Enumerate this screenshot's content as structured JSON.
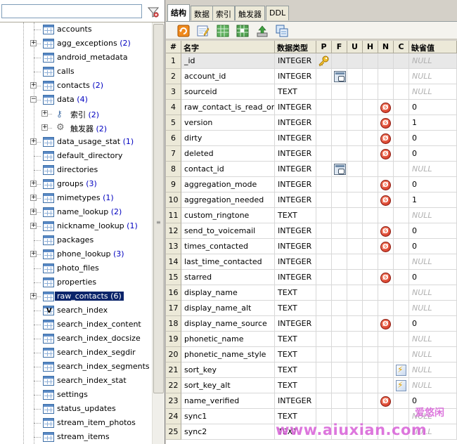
{
  "tabs": [
    {
      "label": "结构",
      "active": true
    },
    {
      "label": "数据",
      "active": false
    },
    {
      "label": "索引",
      "active": false
    },
    {
      "label": "触发器",
      "active": false
    },
    {
      "label": "DDL",
      "active": false
    }
  ],
  "tree": {
    "items": [
      {
        "label": "accounts",
        "count": "",
        "expandable": false,
        "kind": "table"
      },
      {
        "label": "agg_exceptions",
        "count": "(2)",
        "expandable": true,
        "kind": "table"
      },
      {
        "label": "android_metadata",
        "count": "",
        "expandable": false,
        "kind": "table"
      },
      {
        "label": "calls",
        "count": "",
        "expandable": false,
        "kind": "table"
      },
      {
        "label": "contacts",
        "count": "(2)",
        "expandable": true,
        "kind": "table"
      },
      {
        "label": "data",
        "count": "(4)",
        "expandable": true,
        "expanded": true,
        "kind": "table"
      },
      {
        "label": "索引",
        "count": "(2)",
        "expandable": true,
        "kind": "index",
        "child": true
      },
      {
        "label": "触发器",
        "count": "(2)",
        "expandable": true,
        "kind": "trigger",
        "child": true
      },
      {
        "label": "data_usage_stat",
        "count": "(1)",
        "expandable": true,
        "kind": "table"
      },
      {
        "label": "default_directory",
        "count": "",
        "expandable": false,
        "kind": "table"
      },
      {
        "label": "directories",
        "count": "",
        "expandable": false,
        "kind": "table"
      },
      {
        "label": "groups",
        "count": "(3)",
        "expandable": true,
        "kind": "table"
      },
      {
        "label": "mimetypes",
        "count": "(1)",
        "expandable": true,
        "kind": "table"
      },
      {
        "label": "name_lookup",
        "count": "(2)",
        "expandable": true,
        "kind": "table"
      },
      {
        "label": "nickname_lookup",
        "count": "(1)",
        "expandable": true,
        "kind": "table"
      },
      {
        "label": "packages",
        "count": "",
        "expandable": false,
        "kind": "table"
      },
      {
        "label": "phone_lookup",
        "count": "(3)",
        "expandable": true,
        "kind": "table"
      },
      {
        "label": "photo_files",
        "count": "",
        "expandable": false,
        "kind": "table"
      },
      {
        "label": "properties",
        "count": "",
        "expandable": false,
        "kind": "table"
      },
      {
        "label": "raw_contacts",
        "count": "(6)",
        "expandable": true,
        "kind": "table",
        "selected": true
      },
      {
        "label": "search_index",
        "count": "",
        "expandable": false,
        "kind": "virtual"
      },
      {
        "label": "search_index_content",
        "count": "",
        "expandable": false,
        "kind": "table"
      },
      {
        "label": "search_index_docsize",
        "count": "",
        "expandable": false,
        "kind": "table"
      },
      {
        "label": "search_index_segdir",
        "count": "",
        "expandable": false,
        "kind": "table"
      },
      {
        "label": "search_index_segments",
        "count": "",
        "expandable": false,
        "kind": "table"
      },
      {
        "label": "search_index_stat",
        "count": "",
        "expandable": false,
        "kind": "table"
      },
      {
        "label": "settings",
        "count": "",
        "expandable": false,
        "kind": "table"
      },
      {
        "label": "status_updates",
        "count": "",
        "expandable": false,
        "kind": "table"
      },
      {
        "label": "stream_item_photos",
        "count": "",
        "expandable": false,
        "kind": "table"
      },
      {
        "label": "stream_items",
        "count": "",
        "expandable": false,
        "kind": "table"
      }
    ]
  },
  "grid": {
    "headers": [
      "#",
      "名字",
      "数据类型",
      "P",
      "F",
      "U",
      "H",
      "N",
      "C",
      "缺省值"
    ],
    "null_text": "NULL",
    "rows": [
      {
        "n": "1",
        "name": "_id",
        "type": "INTEGER",
        "p": true,
        "f": false,
        "notnull": false,
        "collate": false,
        "def": "NULL",
        "is_null": true
      },
      {
        "n": "2",
        "name": "account_id",
        "type": "INTEGER",
        "p": false,
        "f": true,
        "notnull": false,
        "collate": false,
        "def": "NULL",
        "is_null": true
      },
      {
        "n": "3",
        "name": "sourceid",
        "type": "TEXT",
        "p": false,
        "f": false,
        "notnull": false,
        "collate": false,
        "def": "NULL",
        "is_null": true
      },
      {
        "n": "4",
        "name": "raw_contact_is_read_only",
        "type": "INTEGER",
        "p": false,
        "f": false,
        "notnull": true,
        "collate": false,
        "def": "0",
        "is_null": false
      },
      {
        "n": "5",
        "name": "version",
        "type": "INTEGER",
        "p": false,
        "f": false,
        "notnull": true,
        "collate": false,
        "def": "1",
        "is_null": false
      },
      {
        "n": "6",
        "name": "dirty",
        "type": "INTEGER",
        "p": false,
        "f": false,
        "notnull": true,
        "collate": false,
        "def": "0",
        "is_null": false
      },
      {
        "n": "7",
        "name": "deleted",
        "type": "INTEGER",
        "p": false,
        "f": false,
        "notnull": true,
        "collate": false,
        "def": "0",
        "is_null": false
      },
      {
        "n": "8",
        "name": "contact_id",
        "type": "INTEGER",
        "p": false,
        "f": true,
        "notnull": false,
        "collate": false,
        "def": "NULL",
        "is_null": true
      },
      {
        "n": "9",
        "name": "aggregation_mode",
        "type": "INTEGER",
        "p": false,
        "f": false,
        "notnull": true,
        "collate": false,
        "def": "0",
        "is_null": false
      },
      {
        "n": "10",
        "name": "aggregation_needed",
        "type": "INTEGER",
        "p": false,
        "f": false,
        "notnull": true,
        "collate": false,
        "def": "1",
        "is_null": false
      },
      {
        "n": "11",
        "name": "custom_ringtone",
        "type": "TEXT",
        "p": false,
        "f": false,
        "notnull": false,
        "collate": false,
        "def": "NULL",
        "is_null": true
      },
      {
        "n": "12",
        "name": "send_to_voicemail",
        "type": "INTEGER",
        "p": false,
        "f": false,
        "notnull": true,
        "collate": false,
        "def": "0",
        "is_null": false
      },
      {
        "n": "13",
        "name": "times_contacted",
        "type": "INTEGER",
        "p": false,
        "f": false,
        "notnull": true,
        "collate": false,
        "def": "0",
        "is_null": false
      },
      {
        "n": "14",
        "name": "last_time_contacted",
        "type": "INTEGER",
        "p": false,
        "f": false,
        "notnull": false,
        "collate": false,
        "def": "NULL",
        "is_null": true
      },
      {
        "n": "15",
        "name": "starred",
        "type": "INTEGER",
        "p": false,
        "f": false,
        "notnull": true,
        "collate": false,
        "def": "0",
        "is_null": false
      },
      {
        "n": "16",
        "name": "display_name",
        "type": "TEXT",
        "p": false,
        "f": false,
        "notnull": false,
        "collate": false,
        "def": "NULL",
        "is_null": true
      },
      {
        "n": "17",
        "name": "display_name_alt",
        "type": "TEXT",
        "p": false,
        "f": false,
        "notnull": false,
        "collate": false,
        "def": "NULL",
        "is_null": true
      },
      {
        "n": "18",
        "name": "display_name_source",
        "type": "INTEGER",
        "p": false,
        "f": false,
        "notnull": true,
        "collate": false,
        "def": "0",
        "is_null": false
      },
      {
        "n": "19",
        "name": "phonetic_name",
        "type": "TEXT",
        "p": false,
        "f": false,
        "notnull": false,
        "collate": false,
        "def": "NULL",
        "is_null": true
      },
      {
        "n": "20",
        "name": "phonetic_name_style",
        "type": "TEXT",
        "p": false,
        "f": false,
        "notnull": false,
        "collate": false,
        "def": "NULL",
        "is_null": true
      },
      {
        "n": "21",
        "name": "sort_key",
        "type": "TEXT",
        "p": false,
        "f": false,
        "notnull": false,
        "collate": true,
        "def": "NULL",
        "is_null": true
      },
      {
        "n": "22",
        "name": "sort_key_alt",
        "type": "TEXT",
        "p": false,
        "f": false,
        "notnull": false,
        "collate": true,
        "def": "NULL",
        "is_null": true
      },
      {
        "n": "23",
        "name": "name_verified",
        "type": "INTEGER",
        "p": false,
        "f": false,
        "notnull": true,
        "collate": false,
        "def": "0",
        "is_null": false
      },
      {
        "n": "24",
        "name": "sync1",
        "type": "TEXT",
        "p": false,
        "f": false,
        "notnull": false,
        "collate": false,
        "def": "NULL",
        "is_null": true
      },
      {
        "n": "25",
        "name": "sync2",
        "type": "TEXT",
        "p": false,
        "f": false,
        "notnull": false,
        "collate": false,
        "def": "NULL",
        "is_null": true
      }
    ]
  },
  "watermark": {
    "text": "www.aiuxian.com",
    "top": "爱悠闲"
  },
  "colors": {
    "selection": "#0a246a",
    "count": "#0000c0",
    "null": "#b0b0b0",
    "watermark": "#d860d8"
  },
  "icons": {
    "filter": "filter-icon",
    "refresh": "refresh-icon",
    "edit": "edit-icon",
    "add_column": "add-column-icon",
    "remove_column": "remove-column-icon",
    "move": "move-icon",
    "copy": "copy-icon"
  }
}
